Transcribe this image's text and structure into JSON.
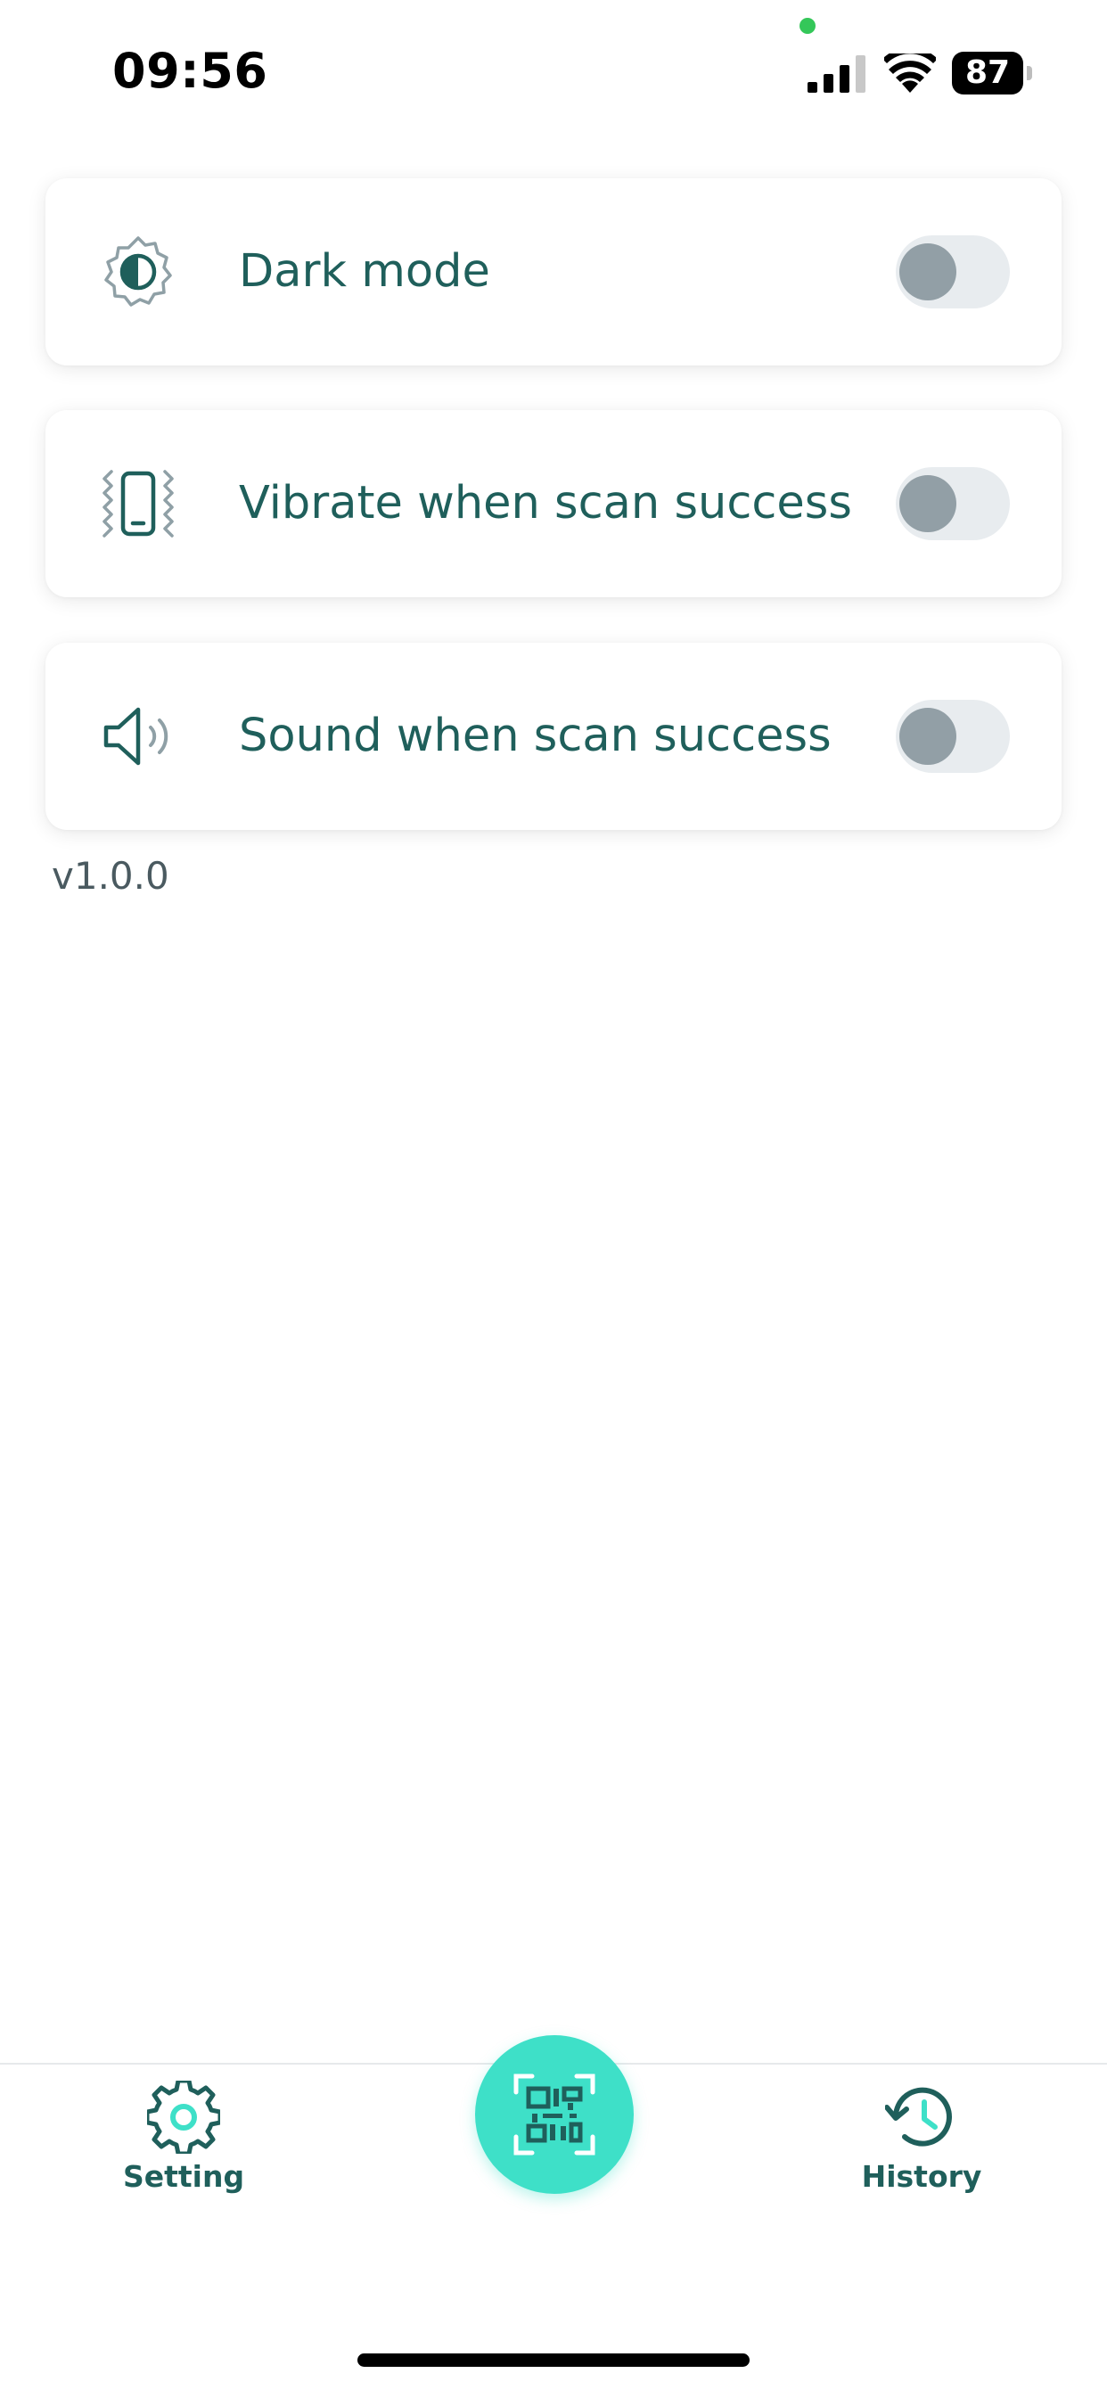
{
  "status_bar": {
    "time": "09:56",
    "battery_level": "87",
    "icons": [
      "signal-icon",
      "wifi-icon",
      "battery-icon"
    ]
  },
  "settings": [
    {
      "label": "Dark mode",
      "icon": "dark-mode-icon",
      "enabled": false
    },
    {
      "label": "Vibrate when scan success",
      "icon": "vibrate-icon",
      "enabled": false
    },
    {
      "label": "Sound when scan success",
      "icon": "sound-icon",
      "enabled": false
    }
  ],
  "version": "v1.0.0",
  "bottom_nav": {
    "setting_label": "Setting",
    "history_label": "History",
    "scan_icon": "qr-scan-icon"
  },
  "colors": {
    "accent": "#3ee0c8",
    "text_primary": "#1f5f5b",
    "toggle_track": "#e8ecef",
    "toggle_knob": "#929fa6",
    "privacy_dot": "#34c759"
  }
}
